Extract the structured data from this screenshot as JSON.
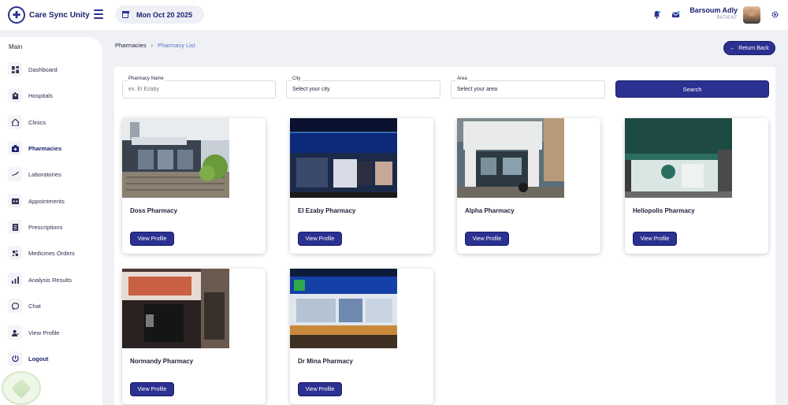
{
  "header": {
    "app_name": "Care Sync Unity",
    "date": "Mon Oct 20 2025",
    "user_name": "Barsoum Adly",
    "user_role": "PATIENT"
  },
  "sidebar": {
    "title": "Main",
    "items": [
      {
        "label": "Dashboard",
        "icon": "dashboard-icon"
      },
      {
        "label": "Hospitals",
        "icon": "hospital-icon"
      },
      {
        "label": "Clinics",
        "icon": "clinic-icon"
      },
      {
        "label": "Pharmacies",
        "icon": "pharmacy-icon",
        "active": true
      },
      {
        "label": "Laboratories",
        "icon": "laboratory-icon"
      },
      {
        "label": "Appointments",
        "icon": "appointments-icon"
      },
      {
        "label": "Prescriptions",
        "icon": "prescription-icon"
      },
      {
        "label": "Medicines Orders",
        "icon": "medicines-icon"
      },
      {
        "label": "Analysis Results",
        "icon": "analysis-icon"
      },
      {
        "label": "Chat",
        "icon": "chat-icon"
      },
      {
        "label": "View Profile",
        "icon": "profile-icon"
      },
      {
        "label": "Logout",
        "icon": "logout-icon"
      }
    ]
  },
  "breadcrumb": {
    "parent": "Pharmacies",
    "current": "Pharmacy List"
  },
  "return_label": "Return Back",
  "filters": {
    "name_label": "Pharmacy Name",
    "name_placeholder": "ex. El Ezaby",
    "city_label": "City",
    "city_value": "Select your city",
    "area_label": "Area",
    "area_value": "Select your area",
    "search_label": "Search"
  },
  "pharmacies": [
    {
      "name": "Doss Pharmacy",
      "button": "View Profile"
    },
    {
      "name": "El Ezaby Pharmacy",
      "button": "View Profile"
    },
    {
      "name": "Alpha Pharmacy",
      "button": "View Profile"
    },
    {
      "name": "Heliopolis Pharmacy",
      "button": "View Profile"
    },
    {
      "name": "Normandy Pharmacy",
      "button": "View Profile"
    },
    {
      "name": "Dr Mina Pharmacy",
      "button": "View Profile"
    }
  ],
  "colors": {
    "primary": "#2b3190",
    "background": "#f0f1f4"
  }
}
